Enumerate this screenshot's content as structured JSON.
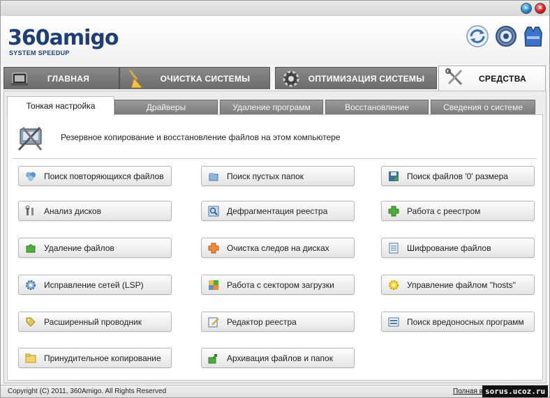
{
  "logo": {
    "main": "360amigo",
    "sub": "SYSTEM SPEEDUP"
  },
  "header_icons": [
    "sync-icon",
    "settings-icon",
    "vest-icon"
  ],
  "main_tabs": [
    {
      "label": "ГЛАВНАЯ",
      "icon": "home-icon",
      "active": false
    },
    {
      "label": "ОЧИСТКА СИСТЕМЫ",
      "icon": "broom-icon",
      "active": false
    },
    {
      "label": "ОПТИМИЗАЦИЯ СИСТЕМЫ",
      "icon": "gear-icon",
      "active": false
    },
    {
      "label": "СРЕДСТВА",
      "icon": "tools-icon",
      "active": true
    }
  ],
  "sub_tabs": [
    {
      "label": "Тонкая настройка",
      "active": true
    },
    {
      "label": "Драйверы",
      "active": false
    },
    {
      "label": "Удаление программ",
      "active": false
    },
    {
      "label": "Восстановление",
      "active": false
    },
    {
      "label": "Сведения о системе",
      "active": false
    }
  ],
  "panel": {
    "description": "Резервное копирование и восстановление файлов на этом компьютере"
  },
  "tools": [
    {
      "label": "Поиск повторяющихся файлов",
      "icon": "duplicate-icon"
    },
    {
      "label": "Поиск пустых папок",
      "icon": "folder-search-icon"
    },
    {
      "label": "Поиск файлов '0' размера",
      "icon": "floppy-icon"
    },
    {
      "label": "Анализ дисков",
      "icon": "wrench-icon"
    },
    {
      "label": "Дефрагментация реестра",
      "icon": "magnifier-icon"
    },
    {
      "label": "Работа с реестром",
      "icon": "plus-icon"
    },
    {
      "label": "Удаление файлов",
      "icon": "puzzle-icon"
    },
    {
      "label": "Очистка следов на дисках",
      "icon": "puzzle-orange-icon"
    },
    {
      "label": "Шифрование файлов",
      "icon": "document-icon"
    },
    {
      "label": "Исправление сетей (LSP)",
      "icon": "gear-small-icon"
    },
    {
      "label": "Работа с сектором загрузки",
      "icon": "puzzle-multi-icon"
    },
    {
      "label": "Управление файлом \"hosts\"",
      "icon": "sun-gear-icon"
    },
    {
      "label": "Расширенный проводник",
      "icon": "tag-icon"
    },
    {
      "label": "Редактор реестра",
      "icon": "edit-icon"
    },
    {
      "label": "Поиск вредоносных программ",
      "icon": "list-icon"
    },
    {
      "label": "Принудительное копирование",
      "icon": "folder-icon"
    },
    {
      "label": "Архивация файлов и папок",
      "icon": "share-icon"
    }
  ],
  "status": {
    "copyright": "Copyright (C) 2011, 360Amigo. All Rights Reserved",
    "full_version": "Полная в",
    "watermark": "sorus.ucoz.ru"
  },
  "colors": {
    "brand": "#1d3f78",
    "tab_inactive": "#7b7b7b",
    "close_button": "#d51515",
    "minimize_button": "#1b7fc9"
  }
}
